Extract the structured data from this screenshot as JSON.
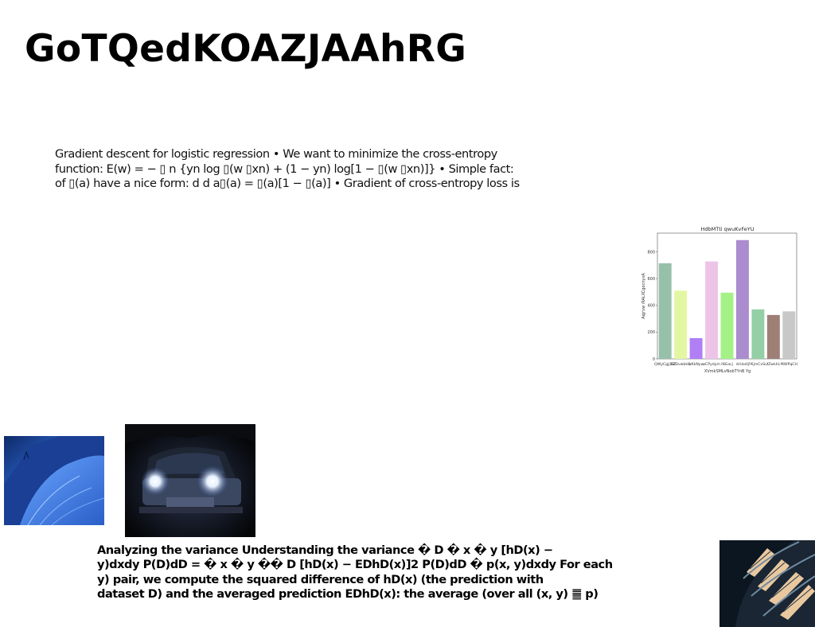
{
  "slide": {
    "title": "GoTQedKOAZJAAhRG",
    "paragraph1": {
      "lines": [
        "Gradient descent for logistic regression • We want to minimize the cross-entropy",
        "function: E(w) = − ▯ n {yn log ▯(w ▯xn) + (1 − yn) log[1 − ▯(w ▯xn)]} • Simple fact:",
        "of ▯(a) have a nice form: d d a▯(a) = ▯(a)[1 − ▯(a)] • Gradient of cross-entropy loss is"
      ]
    },
    "paragraph2": {
      "lines": [
        "Analyzing the variance Understanding the variance � D � x � y [hD(x) −",
        "y)dxdy P(D)dD = � x � y �� D [hD(x) − EDhD(x)]2 P(D)dD � p(x, y)dxdy For each",
        "y) pair, we compute the squared difference of hD(x) (the prediction with",
        "dataset D) and the averaged prediction EDhD(x): the average (over all (x, y) ䷀ p)"
      ]
    },
    "images": [
      {
        "name": "snow-slope-photo"
      },
      {
        "name": "car-headlights-photo"
      },
      {
        "name": "skylight-roof-photo"
      }
    ]
  },
  "chart_data": {
    "type": "bar",
    "title": "HdbMTti qwuKvFeYU",
    "xlabel": "XVmkSMLvNobTYnB Yg",
    "ylabel": "Aqjrvw iRALXCgocnyxA",
    "categories": [
      "QWyCgjjfEZ",
      "aEDvwbkO",
      "wKkNyw",
      "aCPydym",
      "iNGacj",
      "drUodij",
      "YKjmCvSu",
      "fZwkhL",
      "fKWPqCH"
    ],
    "values": [
      715,
      510,
      155,
      728,
      495,
      888,
      370,
      328,
      355
    ],
    "colors": [
      "#96c0aa",
      "#e3f7a3",
      "#b07ef5",
      "#edc4e8",
      "#a4f287",
      "#aa8ccf",
      "#94cfa5",
      "#9d7f76",
      "#c8c8c8"
    ],
    "ylim": [
      0,
      940
    ],
    "yticks": [
      0,
      200,
      400,
      600,
      800
    ],
    "grid": false
  }
}
